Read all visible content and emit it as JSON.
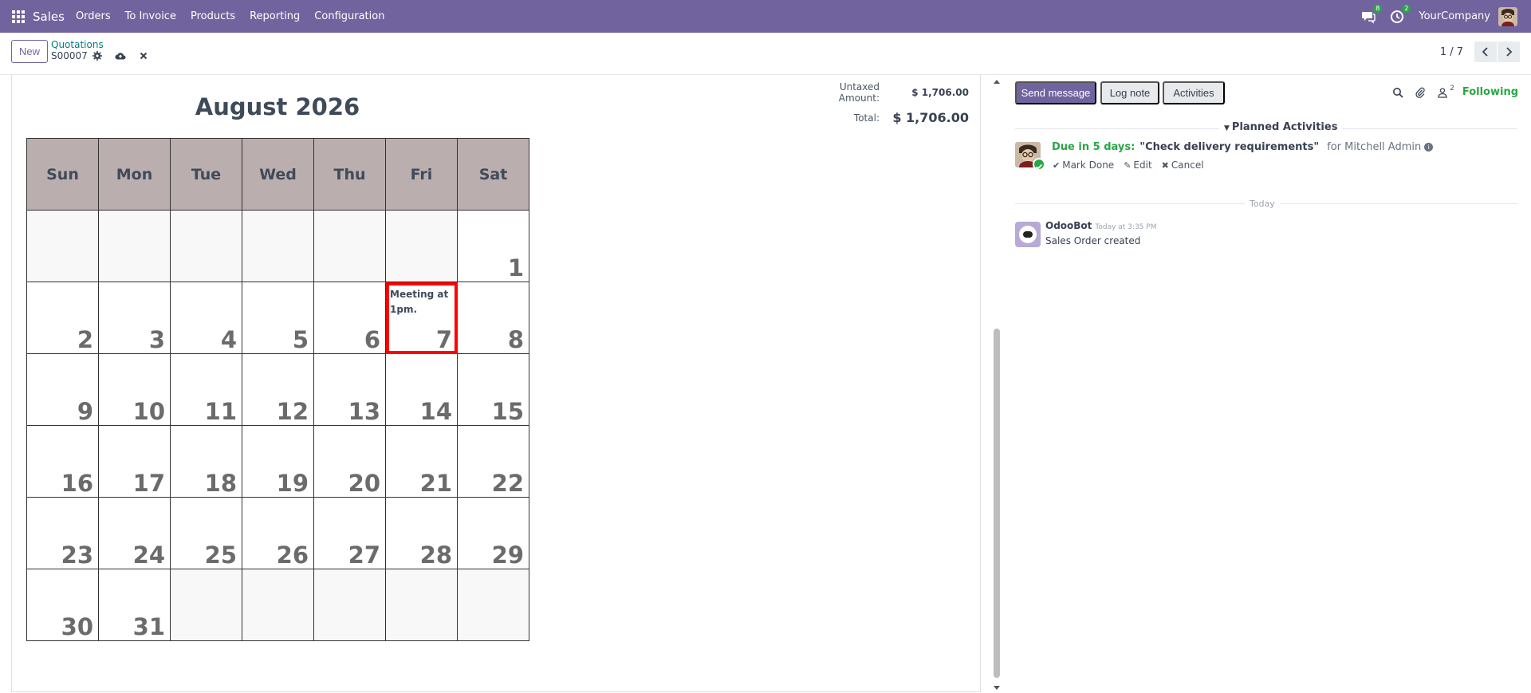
{
  "navbar": {
    "brand": "Sales",
    "menu": [
      "Orders",
      "To Invoice",
      "Products",
      "Reporting",
      "Configuration"
    ],
    "messages_badge": "8",
    "activities_badge": "2",
    "company": "YourCompany"
  },
  "control": {
    "new_label": "New",
    "breadcrumb": "Quotations",
    "record_name": "S00007",
    "pager": "1 / 7"
  },
  "totals": {
    "untaxed_label": "Untaxed Amount:",
    "untaxed_value": "$ 1,706.00",
    "total_label": "Total:",
    "total_value": "$ 1,706.00"
  },
  "calendar": {
    "title": "August 2026",
    "weekdays": [
      "Sun",
      "Mon",
      "Tue",
      "Wed",
      "Thu",
      "Fri",
      "Sat"
    ],
    "cells": [
      "",
      "",
      "",
      "",
      "",
      "",
      "1",
      "2",
      "3",
      "4",
      "5",
      "6",
      "7",
      "8",
      "9",
      "10",
      "11",
      "12",
      "13",
      "14",
      "15",
      "16",
      "17",
      "18",
      "19",
      "20",
      "21",
      "22",
      "23",
      "24",
      "25",
      "26",
      "27",
      "28",
      "29",
      "30",
      "31",
      "",
      "",
      "",
      "",
      ""
    ],
    "note_day": "7",
    "note_text": "Meeting at 1pm."
  },
  "chatter": {
    "send_message": "Send message",
    "log_note": "Log note",
    "activities": "Activities",
    "followers_count": "2",
    "following": "Following",
    "planned_label": "Planned Activities",
    "activity": {
      "due": "Due in 5 days:",
      "title": "\"Check delivery requirements\"",
      "for": "for Mitchell Admin",
      "mark_done": "Mark Done",
      "edit": "Edit",
      "cancel": "Cancel"
    },
    "today_label": "Today",
    "message": {
      "author": "OdooBot",
      "time": "Today at 3:35 PM",
      "body": "Sales Order created"
    }
  }
}
